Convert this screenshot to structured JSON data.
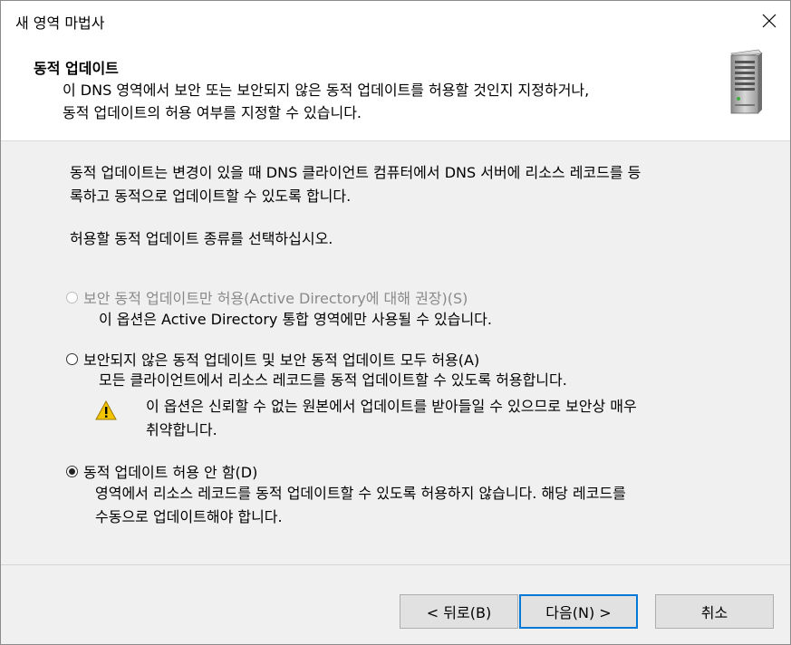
{
  "window": {
    "title": "새 영역 마법사",
    "close_icon": "close-icon"
  },
  "header": {
    "title": "동적 업데이트",
    "description_line1": "이 DNS 영역에서 보안 또는 보안되지 않은 동적 업데이트를 허용할 것인지 지정하거나,",
    "description_line2": "동적 업데이트의 허용 여부를 지정할 수 있습니다.",
    "icon": "server-icon"
  },
  "content": {
    "intro_line1": "동적 업데이트는 변경이 있을 때 DNS 클라이언트 컴퓨터에서 DNS 서버에 리소스 레코드를 등",
    "intro_line2": "록하고 동적으로 업데이트할 수 있도록 합니다.",
    "prompt": "허용할 동적 업데이트 종류를 선택하십시오.",
    "options": [
      {
        "label": "보안 동적 업데이트만 허용(Active Directory에 대해 권장)(S)",
        "note": "이 옵션은 Active Directory 통합 영역에만 사용될 수 있습니다.",
        "enabled": false,
        "selected": false
      },
      {
        "label": "보안되지 않은 동적 업데이트 및 보안 동적 업데이트 모두 허용(A)",
        "note": "모든 클라이언트에서 리소스 레코드를 동적 업데이트할 수 있도록 허용합니다.",
        "warning_line1": "이 옵션은 신뢰할 수 없는 원본에서 업데이트를 받아들일 수 있으므로 보안상 매우",
        "warning_line2": "취약합니다.",
        "enabled": true,
        "selected": false
      },
      {
        "label": "동적 업데이트 허용 안 함(D)",
        "note_line1": "영역에서 리소스 레코드를 동적 업데이트할 수 있도록 허용하지 않습니다. 해당 레코드를",
        "note_line2": "수동으로 업데이트해야 합니다.",
        "enabled": true,
        "selected": true
      }
    ]
  },
  "buttons": {
    "back": "< 뒤로(B)",
    "next": "다음(N) >",
    "cancel": "취소"
  },
  "colors": {
    "focus_border": "#0078d7",
    "dialog_bg": "#f0f0f0",
    "warning_yellow": "#f5c400"
  }
}
